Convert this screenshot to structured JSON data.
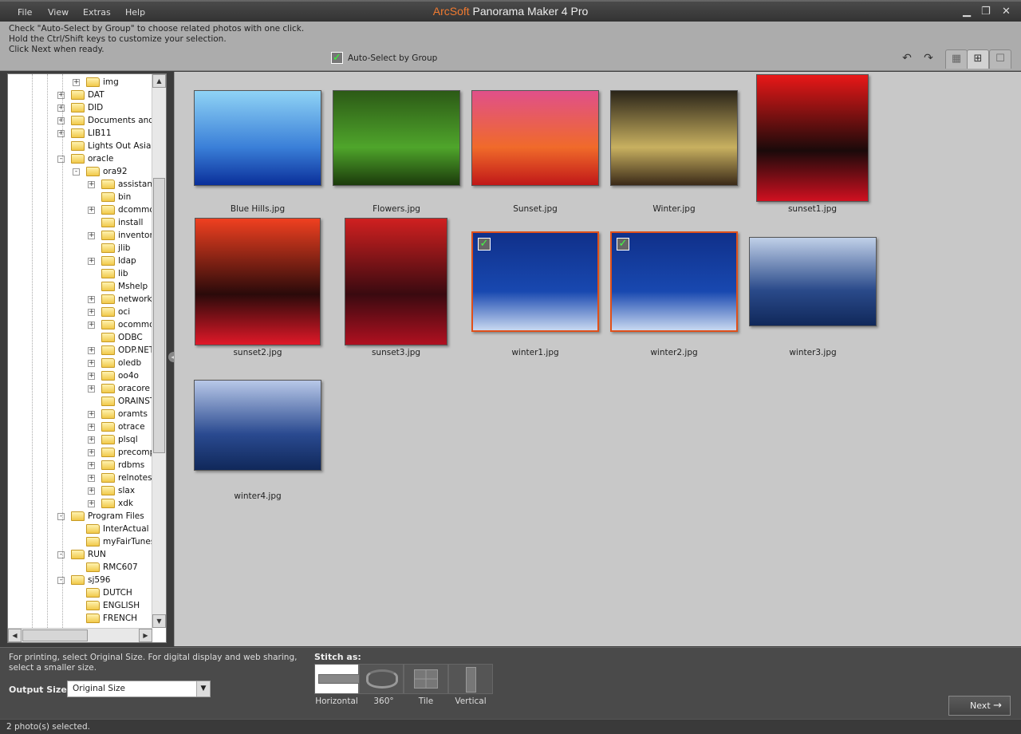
{
  "app": {
    "brand": "ArcSoft",
    "title": "Panorama Maker 4 Pro"
  },
  "menu": [
    "File",
    "View",
    "Extras",
    "Help"
  ],
  "window_controls": {
    "minimize": "minimize-icon",
    "restore": "restore-icon",
    "close": "close-icon"
  },
  "instructions": [
    "Check \"Auto-Select by Group\" to choose related photos with one click.",
    "Hold the Ctrl/Shift keys to customize your selection.",
    "Click Next when ready."
  ],
  "auto_select": {
    "label": "Auto-Select by Group",
    "checked": true
  },
  "toolbar": {
    "rotate_left": "rotate-left-icon",
    "rotate_right": "rotate-right-icon",
    "views": [
      "small-thumbnails",
      "medium-thumbnails",
      "large-thumbnail"
    ],
    "active_view": "medium-thumbnails"
  },
  "tree": [
    {
      "label": "img",
      "level": 3,
      "exp": "+"
    },
    {
      "label": "DAT",
      "level": 2,
      "exp": "+"
    },
    {
      "label": "DID",
      "level": 2,
      "exp": "+"
    },
    {
      "label": "Documents and Setti",
      "level": 2,
      "exp": "+"
    },
    {
      "label": "LIB11",
      "level": 2,
      "exp": "+"
    },
    {
      "label": "Lights Out Asia",
      "level": 2,
      "exp": ""
    },
    {
      "label": "oracle",
      "level": 2,
      "exp": "-"
    },
    {
      "label": "ora92",
      "level": 3,
      "exp": "-"
    },
    {
      "label": "assistants",
      "level": 4,
      "exp": "+"
    },
    {
      "label": "bin",
      "level": 4,
      "exp": ""
    },
    {
      "label": "dcommon",
      "level": 4,
      "exp": "+"
    },
    {
      "label": "install",
      "level": 4,
      "exp": ""
    },
    {
      "label": "inventory",
      "level": 4,
      "exp": "+"
    },
    {
      "label": "jlib",
      "level": 4,
      "exp": ""
    },
    {
      "label": "ldap",
      "level": 4,
      "exp": "+"
    },
    {
      "label": "lib",
      "level": 4,
      "exp": ""
    },
    {
      "label": "Mshelp",
      "level": 4,
      "exp": ""
    },
    {
      "label": "network",
      "level": 4,
      "exp": "+"
    },
    {
      "label": "oci",
      "level": 4,
      "exp": "+"
    },
    {
      "label": "ocommon",
      "level": 4,
      "exp": "+"
    },
    {
      "label": "ODBC",
      "level": 4,
      "exp": ""
    },
    {
      "label": "ODP.NET",
      "level": 4,
      "exp": "+"
    },
    {
      "label": "oledb",
      "level": 4,
      "exp": "+"
    },
    {
      "label": "oo4o",
      "level": 4,
      "exp": "+"
    },
    {
      "label": "oracore",
      "level": 4,
      "exp": "+"
    },
    {
      "label": "ORAINST",
      "level": 4,
      "exp": ""
    },
    {
      "label": "oramts",
      "level": 4,
      "exp": "+"
    },
    {
      "label": "otrace",
      "level": 4,
      "exp": "+"
    },
    {
      "label": "plsql",
      "level": 4,
      "exp": "+"
    },
    {
      "label": "precomp",
      "level": 4,
      "exp": "+"
    },
    {
      "label": "rdbms",
      "level": 4,
      "exp": "+"
    },
    {
      "label": "relnotes",
      "level": 4,
      "exp": "+"
    },
    {
      "label": "slax",
      "level": 4,
      "exp": "+"
    },
    {
      "label": "xdk",
      "level": 4,
      "exp": "+"
    },
    {
      "label": "Program Files",
      "level": 2,
      "exp": "-"
    },
    {
      "label": "InterActual",
      "level": 3,
      "exp": ""
    },
    {
      "label": "myFairTunes",
      "level": 3,
      "exp": ""
    },
    {
      "label": "RUN",
      "level": 2,
      "exp": "-"
    },
    {
      "label": "RMC607",
      "level": 3,
      "exp": ""
    },
    {
      "label": "sj596",
      "level": 2,
      "exp": "-"
    },
    {
      "label": "DUTCH",
      "level": 3,
      "exp": ""
    },
    {
      "label": "ENGLISH",
      "level": 3,
      "exp": ""
    },
    {
      "label": "FRENCH",
      "level": 3,
      "exp": ""
    }
  ],
  "photos": [
    {
      "name": "Blue Hills.jpg",
      "selected": false,
      "colors": [
        "#8fd3f5",
        "#3a7fd8",
        "#0a2f9a"
      ]
    },
    {
      "name": "Flowers.jpg",
      "selected": false,
      "colors": [
        "#2c5a16",
        "#4fa52b",
        "#1b3a0b"
      ]
    },
    {
      "name": "Sunset.jpg",
      "selected": false,
      "colors": [
        "#e0508a",
        "#f06a2a",
        "#c01818"
      ]
    },
    {
      "name": "Winter.jpg",
      "selected": false,
      "colors": [
        "#2a2418",
        "#c8b060",
        "#3a2a18"
      ]
    },
    {
      "name": "sunset1.jpg",
      "selected": false,
      "colors": [
        "#e81818",
        "#1a0a0a",
        "#d01020"
      ]
    },
    {
      "name": "sunset2.jpg",
      "selected": false,
      "colors": [
        "#f04020",
        "#2a0a0a",
        "#e01828"
      ]
    },
    {
      "name": "sunset3.jpg",
      "selected": false,
      "colors": [
        "#d02020",
        "#3a0a10",
        "#b01020"
      ]
    },
    {
      "name": "winter1.jpg",
      "selected": true,
      "colors": [
        "#10308a",
        "#1848b0",
        "#c8d8f0"
      ]
    },
    {
      "name": "winter2.jpg",
      "selected": true,
      "colors": [
        "#10308a",
        "#1848b0",
        "#c8d8f0"
      ]
    },
    {
      "name": "winter3.jpg",
      "selected": false,
      "colors": [
        "#c0d0e8",
        "#2a4a8a",
        "#10285a"
      ]
    },
    {
      "name": "winter4.jpg",
      "selected": false,
      "colors": [
        "#b8c8e8",
        "#2a4a90",
        "#10285a"
      ]
    }
  ],
  "bottom": {
    "hint": "For printing, select Original Size. For digital display and web sharing, select a smaller size.",
    "output_label": "Output Size:",
    "output_value": "Original Size",
    "stitch_label": "Stitch as:",
    "stitch_options": [
      "Horizontal",
      "360°",
      "Tile",
      "Vertical"
    ],
    "stitch_selected": "Horizontal",
    "next": "Next"
  },
  "status": "2 photo(s) selected."
}
